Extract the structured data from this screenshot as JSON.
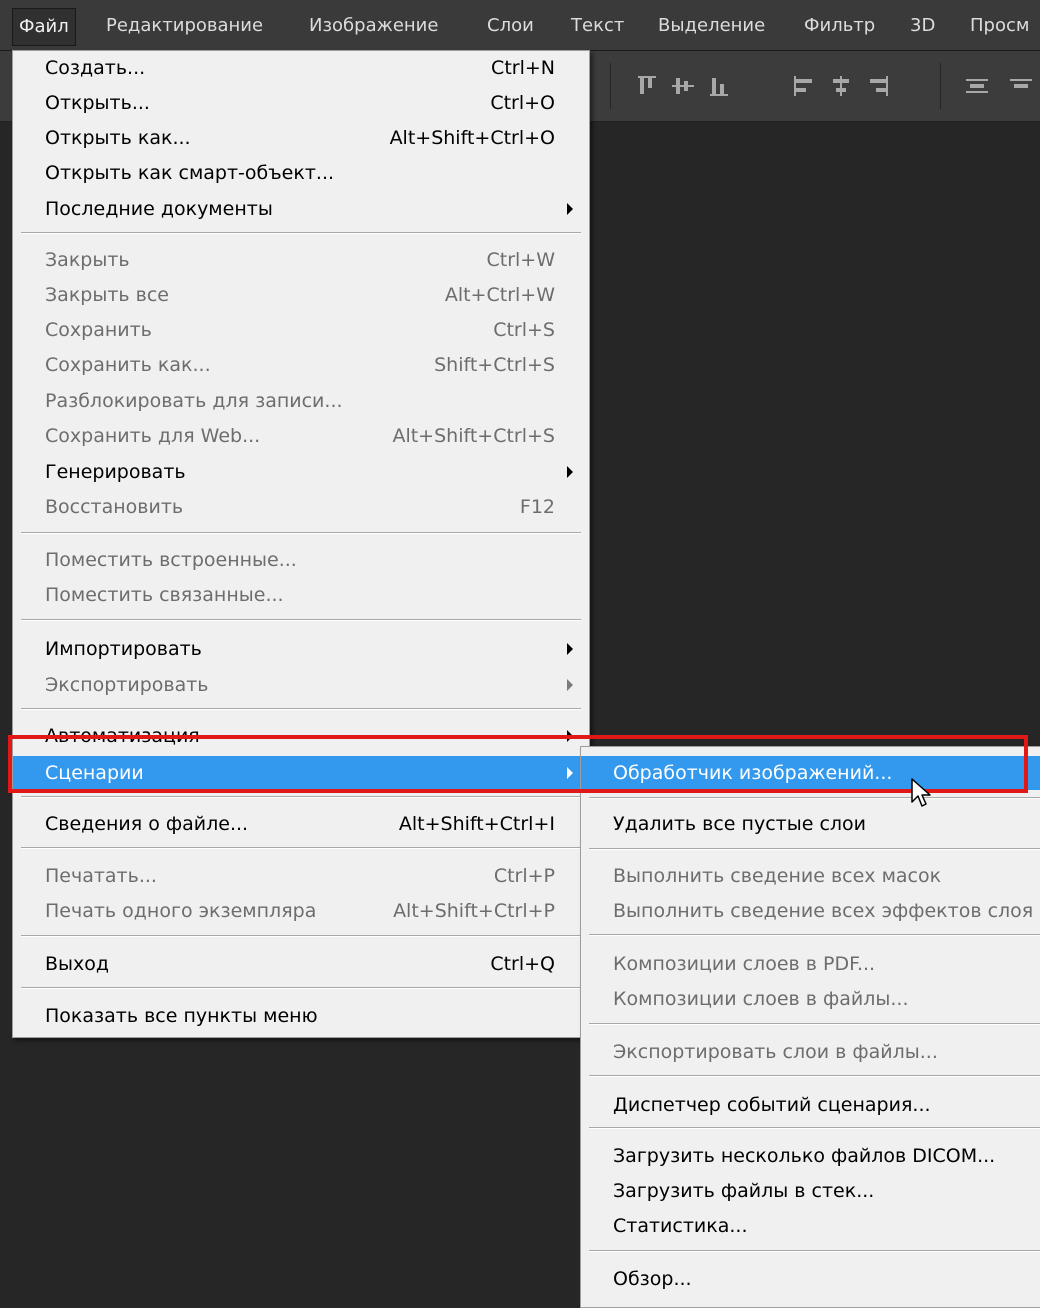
{
  "menubar": {
    "items": [
      {
        "label": "Файл"
      },
      {
        "label": "Редактирование"
      },
      {
        "label": "Изображение"
      },
      {
        "label": "Слои"
      },
      {
        "label": "Текст"
      },
      {
        "label": "Выделение"
      },
      {
        "label": "Фильтр"
      },
      {
        "label": "3D"
      },
      {
        "label": "Просм"
      }
    ]
  },
  "options_bar": {
    "icons": [
      "align-top-edges-icon",
      "align-vertical-centers-icon",
      "align-bottom-edges-icon",
      "align-left-edges-icon",
      "align-horizontal-centers-icon",
      "align-right-edges-icon",
      "distribute-top-icon",
      "distribute-vcenter-icon"
    ]
  },
  "file_menu": {
    "items": [
      {
        "label": "Создать...",
        "shortcut": "Ctrl+N"
      },
      {
        "label": "Открыть...",
        "shortcut": "Ctrl+O"
      },
      {
        "label": "Открыть как...",
        "shortcut": "Alt+Shift+Ctrl+O"
      },
      {
        "label": "Открыть как смарт-объект..."
      },
      {
        "label": "Последние документы"
      },
      {
        "label": "Закрыть",
        "shortcut": "Ctrl+W"
      },
      {
        "label": "Закрыть все",
        "shortcut": "Alt+Ctrl+W"
      },
      {
        "label": "Сохранить",
        "shortcut": "Ctrl+S"
      },
      {
        "label": "Сохранить как...",
        "shortcut": "Shift+Ctrl+S"
      },
      {
        "label": "Разблокировать для записи..."
      },
      {
        "label": "Сохранить для Web...",
        "shortcut": "Alt+Shift+Ctrl+S"
      },
      {
        "label": "Генерировать"
      },
      {
        "label": "Восстановить",
        "shortcut": "F12"
      },
      {
        "label": "Поместить встроенные..."
      },
      {
        "label": "Поместить связанные..."
      },
      {
        "label": "Импортировать"
      },
      {
        "label": "Экспортировать"
      },
      {
        "label": "Автоматизация"
      },
      {
        "label": "Сценарии"
      },
      {
        "label": "Сведения о файле...",
        "shortcut": "Alt+Shift+Ctrl+I"
      },
      {
        "label": "Печатать...",
        "shortcut": "Ctrl+P"
      },
      {
        "label": "Печать одного экземпляра",
        "shortcut": "Alt+Shift+Ctrl+P"
      },
      {
        "label": "Выход",
        "shortcut": "Ctrl+Q"
      },
      {
        "label": "Показать все пункты меню"
      }
    ]
  },
  "scripts_submenu": {
    "items": [
      {
        "label": "Обработчик изображений..."
      },
      {
        "label": "Удалить все пустые слои"
      },
      {
        "label": "Выполнить сведение всех масок"
      },
      {
        "label": "Выполнить сведение всех эффектов слоя"
      },
      {
        "label": "Композиции слоев в PDF..."
      },
      {
        "label": "Композиции слоев в файлы..."
      },
      {
        "label": "Экспортировать слои в файлы..."
      },
      {
        "label": "Диспетчер событий сценария..."
      },
      {
        "label": "Загрузить несколько файлов DICOM..."
      },
      {
        "label": "Загрузить файлы в стек..."
      },
      {
        "label": "Статистика..."
      },
      {
        "label": "Обзор..."
      }
    ]
  },
  "colors": {
    "highlight": "#3399ee",
    "annotation_box": "#e01818",
    "menu_bg": "#f0f0f0",
    "canvas_bg": "#262626"
  }
}
